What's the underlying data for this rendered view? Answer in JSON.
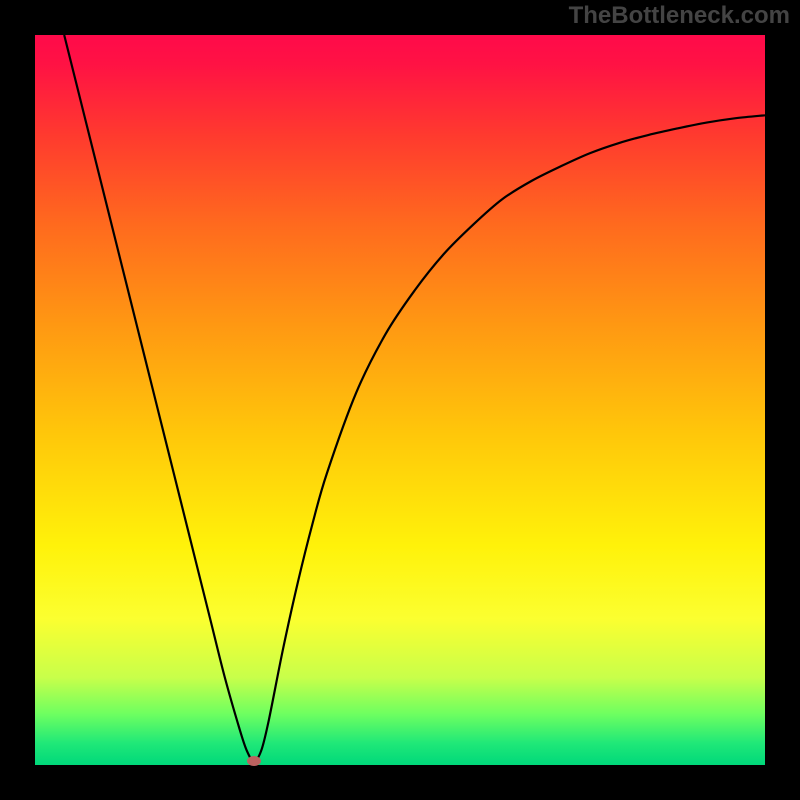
{
  "domain": "Chart",
  "watermark": "TheBottleneck.com",
  "chart_data": {
    "type": "line",
    "title": "",
    "xlabel": "",
    "ylabel": "",
    "xlim": [
      0,
      100
    ],
    "ylim": [
      0,
      100
    ],
    "x": [
      4,
      6,
      8,
      10,
      12,
      14,
      16,
      18,
      20,
      22,
      24,
      26,
      28,
      29,
      30,
      31,
      32,
      34,
      36,
      38,
      40,
      44,
      48,
      52,
      56,
      60,
      64,
      68,
      72,
      76,
      80,
      84,
      88,
      92,
      96,
      100
    ],
    "values": [
      100,
      92,
      84,
      76,
      68,
      60,
      52,
      44,
      36,
      28,
      20,
      12,
      5,
      2,
      0.5,
      2,
      6,
      16,
      25,
      33,
      40,
      51,
      59,
      65,
      70,
      74,
      77.5,
      80,
      82,
      83.8,
      85.2,
      86.3,
      87.2,
      88,
      88.6,
      89
    ],
    "marker": {
      "x": 30,
      "y": 0.5
    },
    "background_gradient": {
      "top": "#ff0a4a",
      "mid_upper": "#ff9912",
      "mid_lower": "#fff20a",
      "bottom": "#00d87a"
    }
  }
}
